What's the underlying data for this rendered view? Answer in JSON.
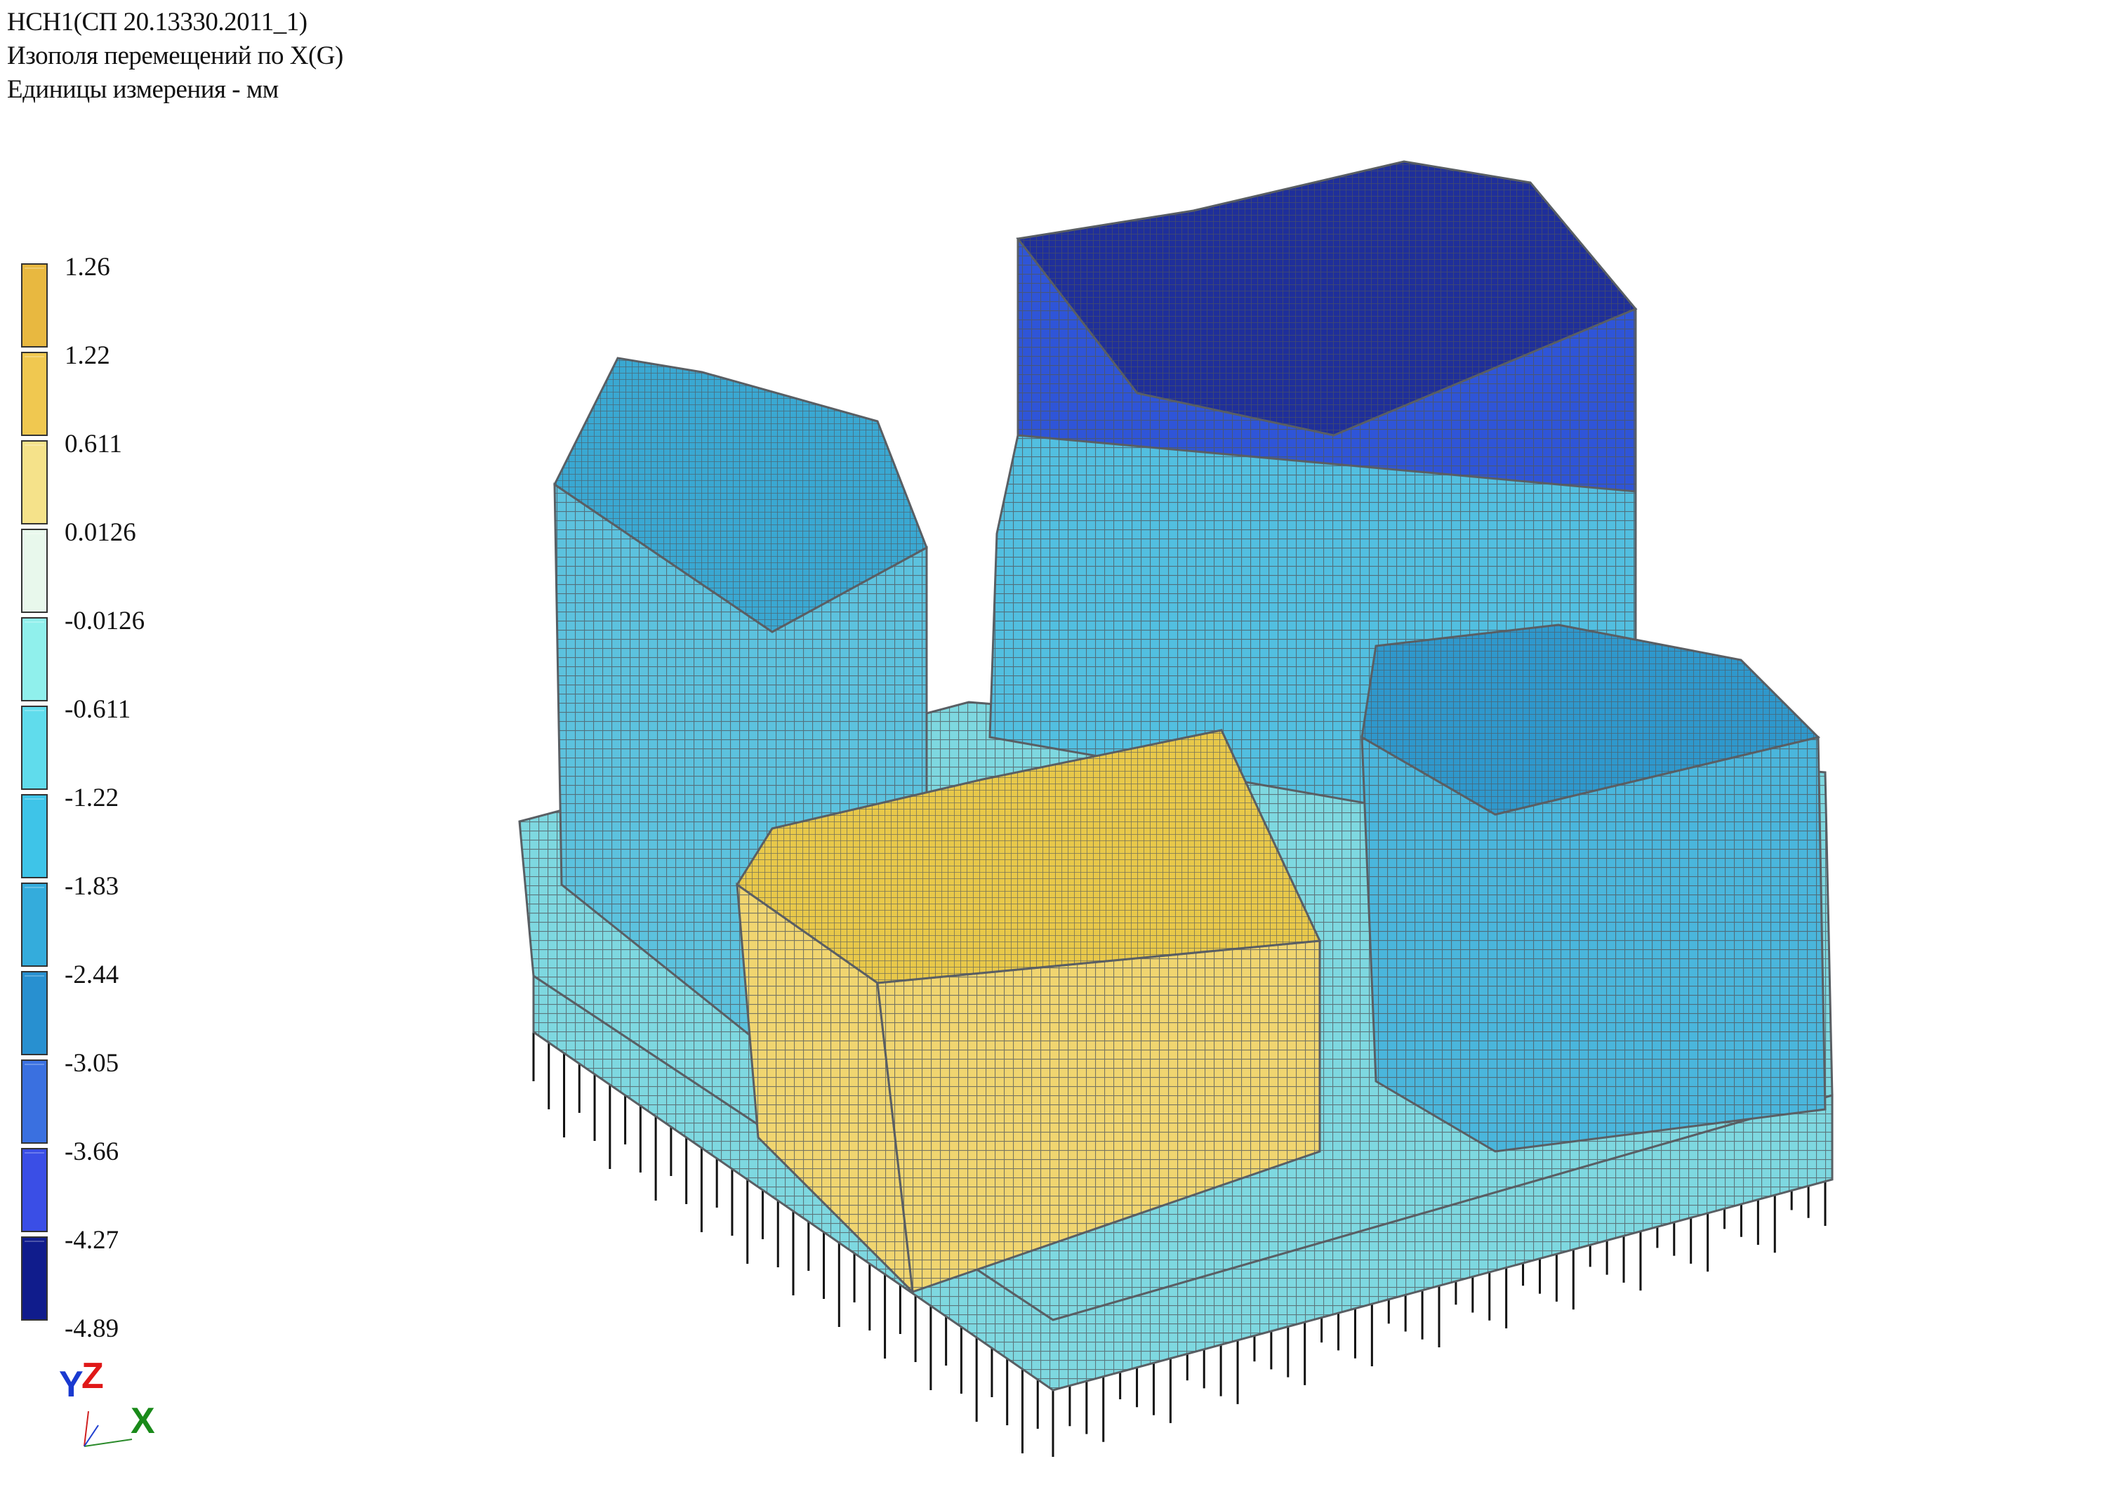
{
  "header": {
    "line1": "НСН1(СП 20.13330.2011_1)",
    "line2": "Изополя перемещений по X(G)",
    "line3": "Единицы измерения - мм"
  },
  "legend": {
    "values": [
      "1.26",
      "1.22",
      "0.611",
      "0.0126",
      "-0.0126",
      "-0.611",
      "-1.22",
      "-1.83",
      "-2.44",
      "-3.05",
      "-3.66",
      "-4.27",
      "-4.89"
    ],
    "colors": [
      "#e8b840",
      "#f0c850",
      "#f5e28a",
      "#e8f8ec",
      "#90f0ec",
      "#60dcec",
      "#3ec4e8",
      "#34acdc",
      "#2890d0",
      "#3a70e0",
      "#3a4ee6",
      "#101c8c"
    ]
  },
  "axes": {
    "y": "Y",
    "z": "Z",
    "x": "X",
    "y_color": "#1a3ad0",
    "z_color": "#e01818",
    "x_color": "#1a8a1a"
  },
  "model": {
    "mesh_color": "#555a60",
    "pile_color": "#111111",
    "parts": [
      {
        "name": "slab",
        "fill": "#7ed8e0"
      },
      {
        "name": "left-tower-wall",
        "fill": "#5cc2de"
      },
      {
        "name": "left-tower-roof",
        "fill": "#3aa8d2"
      },
      {
        "name": "rear-tower-wall-upper",
        "fill": "#2f55d8"
      },
      {
        "name": "rear-tower-wall-lower",
        "fill": "#52bfe0"
      },
      {
        "name": "rear-tower-roof",
        "fill": "#1f2f9a"
      },
      {
        "name": "right-tower-wall",
        "fill": "#4ab6dc"
      },
      {
        "name": "right-tower-roof",
        "fill": "#2f98cc"
      },
      {
        "name": "front-tower-wall",
        "fill": "#f0d570"
      },
      {
        "name": "front-tower-roof",
        "fill": "#e8c84a"
      }
    ]
  }
}
